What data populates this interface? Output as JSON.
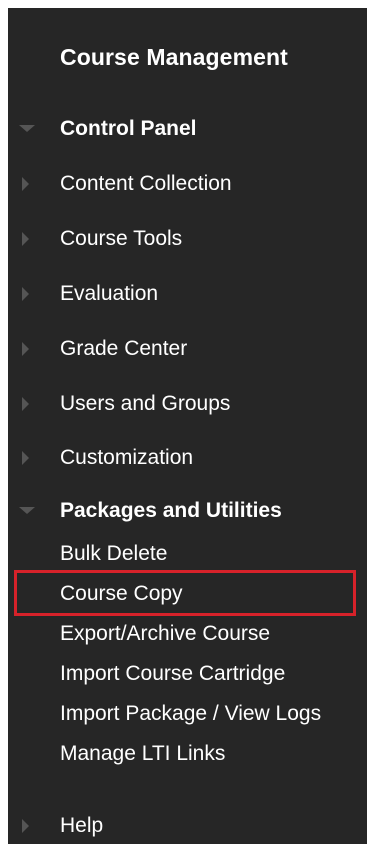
{
  "panel": {
    "title": "Course Management",
    "sections": [
      {
        "label": "Control Panel",
        "expanded": true
      },
      {
        "label": "Content Collection",
        "expanded": false
      },
      {
        "label": "Course Tools",
        "expanded": false
      },
      {
        "label": "Evaluation",
        "expanded": false
      },
      {
        "label": "Grade Center",
        "expanded": false
      },
      {
        "label": "Users and Groups",
        "expanded": false
      },
      {
        "label": "Customization",
        "expanded": false
      },
      {
        "label": "Packages and Utilities",
        "expanded": true
      },
      {
        "label": "Help",
        "expanded": false
      }
    ],
    "utilities": [
      "Bulk Delete",
      "Course Copy",
      "Export/Archive Course",
      "Import Course Cartridge",
      "Import Package / View Logs",
      "Manage LTI Links"
    ],
    "highlighted_item": "Course Copy"
  },
  "colors": {
    "panel_background": "#262626",
    "text": "#ffffff",
    "arrow": "#555555",
    "highlight_border": "#d6222a"
  },
  "icons": {
    "collapsed": "triangle-right-icon",
    "expanded": "triangle-down-icon"
  }
}
